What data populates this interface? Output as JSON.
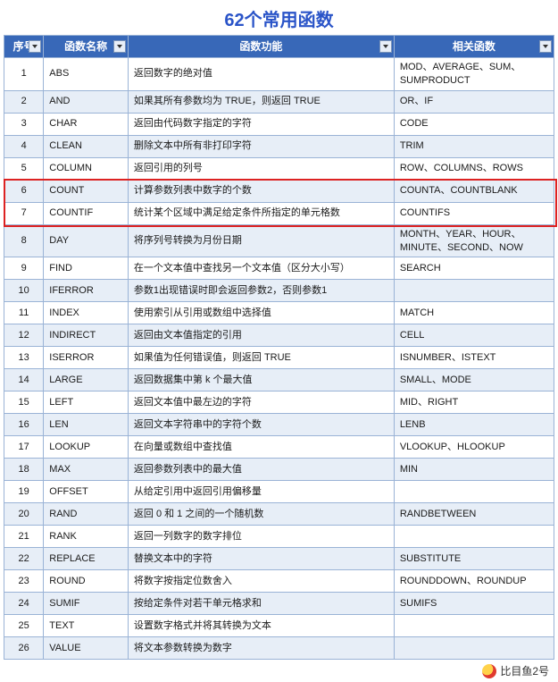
{
  "title": "62个常用函数",
  "headers": {
    "idx": "序号",
    "name": "函数名称",
    "func": "函数功能",
    "rel": "相关函数"
  },
  "highlight_rows": [
    6,
    7
  ],
  "rows": [
    {
      "idx": 1,
      "name": "ABS",
      "func": "返回数字的绝对值",
      "rel": "MOD、AVERAGE、SUM、SUMPRODUCT"
    },
    {
      "idx": 2,
      "name": "AND",
      "func": "如果其所有参数均为 TRUE，则返回 TRUE",
      "rel": "OR、IF"
    },
    {
      "idx": 3,
      "name": "CHAR",
      "func": "返回由代码数字指定的字符",
      "rel": "CODE"
    },
    {
      "idx": 4,
      "name": "CLEAN",
      "func": "删除文本中所有非打印字符",
      "rel": "TRIM"
    },
    {
      "idx": 5,
      "name": "COLUMN",
      "func": "返回引用的列号",
      "rel": "ROW、COLUMNS、ROWS"
    },
    {
      "idx": 6,
      "name": "COUNT",
      "func": "计算参数列表中数字的个数",
      "rel": "COUNTA、COUNTBLANK"
    },
    {
      "idx": 7,
      "name": "COUNTIF",
      "func": "统计某个区域中满足给定条件所指定的单元格数",
      "rel": "COUNTIFS"
    },
    {
      "idx": 8,
      "name": "DAY",
      "func": "将序列号转换为月份日期",
      "rel": "MONTH、YEAR、HOUR、MINUTE、SECOND、NOW"
    },
    {
      "idx": 9,
      "name": "FIND",
      "func": "在一个文本值中查找另一个文本值（区分大小写）",
      "rel": "SEARCH"
    },
    {
      "idx": 10,
      "name": "IFERROR",
      "func": "参数1出现错误时即会返回参数2，否则参数1",
      "rel": ""
    },
    {
      "idx": 11,
      "name": "INDEX",
      "func": "使用索引从引用或数组中选择值",
      "rel": "MATCH"
    },
    {
      "idx": 12,
      "name": "INDIRECT",
      "func": "返回由文本值指定的引用",
      "rel": "CELL"
    },
    {
      "idx": 13,
      "name": "ISERROR",
      "func": "如果值为任何错误值，则返回 TRUE",
      "rel": "ISNUMBER、ISTEXT"
    },
    {
      "idx": 14,
      "name": "LARGE",
      "func": "返回数据集中第 k 个最大值",
      "rel": "SMALL、MODE"
    },
    {
      "idx": 15,
      "name": "LEFT",
      "func": "返回文本值中最左边的字符",
      "rel": "MID、RIGHT"
    },
    {
      "idx": 16,
      "name": "LEN",
      "func": "返回文本字符串中的字符个数",
      "rel": "LENB"
    },
    {
      "idx": 17,
      "name": "LOOKUP",
      "func": "在向量或数组中查找值",
      "rel": "VLOOKUP、HLOOKUP"
    },
    {
      "idx": 18,
      "name": "MAX",
      "func": "返回参数列表中的最大值",
      "rel": "MIN"
    },
    {
      "idx": 19,
      "name": "OFFSET",
      "func": "从给定引用中返回引用偏移量",
      "rel": ""
    },
    {
      "idx": 20,
      "name": "RAND",
      "func": "返回 0 和 1 之间的一个随机数",
      "rel": "RANDBETWEEN"
    },
    {
      "idx": 21,
      "name": "RANK",
      "func": "返回一列数字的数字排位",
      "rel": ""
    },
    {
      "idx": 22,
      "name": "REPLACE",
      "func": "替换文本中的字符",
      "rel": "SUBSTITUTE"
    },
    {
      "idx": 23,
      "name": "ROUND",
      "func": "将数字按指定位数舍入",
      "rel": "ROUNDDOWN、ROUNDUP"
    },
    {
      "idx": 24,
      "name": "SUMIF",
      "func": "按给定条件对若干单元格求和",
      "rel": "SUMIFS"
    },
    {
      "idx": 25,
      "name": "TEXT",
      "func": "设置数字格式并将其转换为文本",
      "rel": ""
    },
    {
      "idx": 26,
      "name": "VALUE",
      "func": "将文本参数转换为数字",
      "rel": ""
    }
  ],
  "footer": "比目鱼2号"
}
